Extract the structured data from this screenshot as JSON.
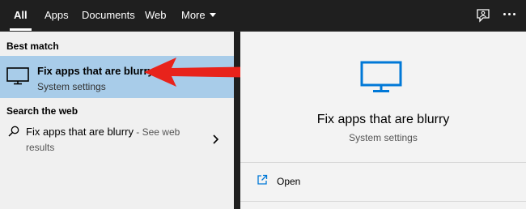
{
  "nav": {
    "tabs": [
      {
        "label": "All",
        "active": true
      },
      {
        "label": "Apps"
      },
      {
        "label": "Documents"
      },
      {
        "label": "Web"
      },
      {
        "label": "More"
      }
    ]
  },
  "left": {
    "best_match_label": "Best match",
    "best_item": {
      "title": "Fix apps that are blurry",
      "subtitle": "System settings",
      "icon": "monitor-icon"
    },
    "search_web_label": "Search the web",
    "web_item": {
      "title": "Fix apps that are blurry",
      "suffix": " - See web",
      "suffix2": "results",
      "icon": "search-icon"
    }
  },
  "right": {
    "title": "Fix apps that are blurry",
    "subtitle": "System settings",
    "actions": [
      {
        "label": "Open",
        "icon": "open-icon"
      }
    ]
  },
  "colors": {
    "accent": "#0078d7",
    "selection": "#a8cce9",
    "annotation_arrow": "#e8231b",
    "topbar": "#1f1f1f"
  }
}
